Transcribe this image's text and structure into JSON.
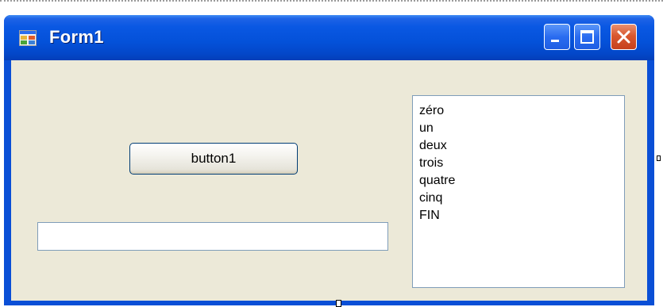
{
  "window": {
    "title": "Form1",
    "icon": "app-form-icon",
    "controls": {
      "minimize_icon": "minimize-icon",
      "maximize_icon": "maximize-icon",
      "close_icon": "close-icon"
    }
  },
  "form": {
    "button1_label": "button1",
    "textbox_value": "",
    "listbox_items": [
      "zéro",
      "un",
      "deux",
      "trois",
      "quatre",
      "cinq",
      "FIN"
    ]
  },
  "colors": {
    "titlebar": "#0451d9",
    "client_background": "#ece9d8",
    "close_button": "#d9582f"
  }
}
